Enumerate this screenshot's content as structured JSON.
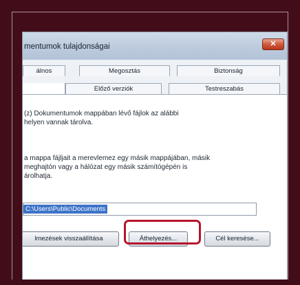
{
  "window": {
    "title": "mentumok tulajdonságai",
    "close_symbol": "✕"
  },
  "tabs": {
    "row1": [
      "álnos",
      "Megosztás",
      "Biztonság"
    ],
    "row2": [
      "",
      "Előző verziók",
      "Testreszabás"
    ]
  },
  "panel": {
    "paragraph1_line1": "(z) Dokumentumok mappában lévő fájlok az alábbi",
    "paragraph1_line2": "helyen vannak tárolva.",
    "paragraph2_line1": "a mappa fájljait a merevlemez egy másik mappájában, másik",
    "paragraph2_line2": "meghajtón vagy a hálózat egy másik számítógépén is",
    "paragraph2_line3": "árolhatja.",
    "path_value": "C:\\Users\\Public\\Documents"
  },
  "buttons": {
    "restore_defaults": "lmezések visszaállítása",
    "move": "Áthelyezés...",
    "find_target": "Cél keresése..."
  },
  "colors": {
    "backdrop": "#420d19",
    "highlight": "#b5142b",
    "selection": "#3d73c9"
  }
}
